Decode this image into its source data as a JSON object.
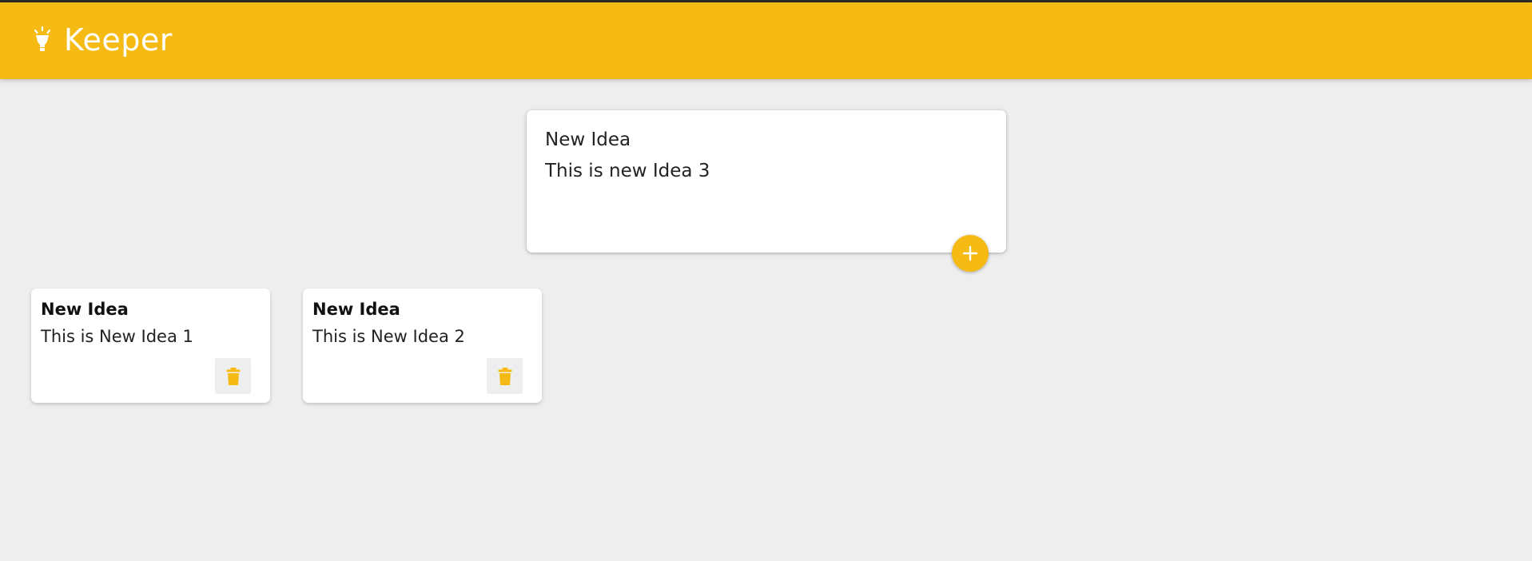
{
  "app": {
    "title": "Keeper",
    "icon": "lightbulb-icon",
    "accent_color": "#f5ba13",
    "background_color": "#eeeeee"
  },
  "create_note": {
    "title_value": "New Idea",
    "content_value": "This is new Idea 3",
    "add_button_label": "+",
    "add_icon": "plus-icon"
  },
  "notes": [
    {
      "title": "New Idea",
      "content": "This is New Idea 1",
      "delete_icon": "trash-icon"
    },
    {
      "title": "New Idea",
      "content": "This is New Idea 2",
      "delete_icon": "trash-icon"
    }
  ]
}
